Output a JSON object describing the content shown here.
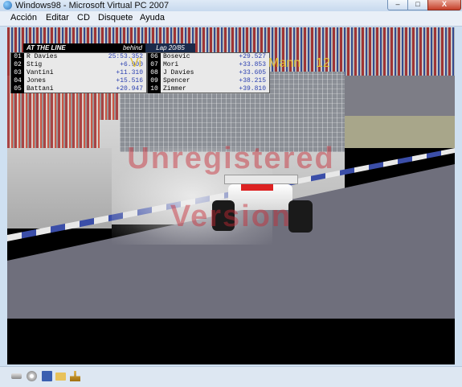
{
  "window": {
    "title": "Windows98 - Microsoft Virtual PC 2007",
    "controls": {
      "minimize": "‒",
      "maximize": "□",
      "close": "X"
    }
  },
  "menu": {
    "items": [
      "Acción",
      "Editar",
      "CD",
      "Disquete",
      "Ayuda"
    ]
  },
  "game": {
    "timing_header": "AT THE LINE",
    "behind_label": "behind",
    "lap_label": "Lap 20/85",
    "left_rows": [
      {
        "pos": "01",
        "name": "R Davies",
        "time": "25:53.352"
      },
      {
        "pos": "02",
        "name": "Stig",
        "time": "+6.900"
      },
      {
        "pos": "03",
        "name": "Vantini",
        "time": "+11.310"
      },
      {
        "pos": "04",
        "name": "Jones",
        "time": "+15.516"
      },
      {
        "pos": "05",
        "name": "Battani",
        "time": "+20.947"
      }
    ],
    "right_rows": [
      {
        "pos": "06",
        "name": "Bosevic",
        "time": "+29.527"
      },
      {
        "pos": "07",
        "name": "Mori",
        "time": "+33.853"
      },
      {
        "pos": "08",
        "name": "J Davies",
        "time": "+33.605"
      },
      {
        "pos": "09",
        "name": "Spencer",
        "time": "+38.215"
      },
      {
        "pos": "10",
        "name": "Zimmer",
        "time": "+39.810"
      }
    ],
    "driver_label_left": "Vi",
    "driver_label_right": "Mann",
    "driver_position": "12",
    "watermark_line1": "Unregistered",
    "watermark_line2": "Version"
  },
  "statusbar": {
    "icons": [
      "hard-disk-icon",
      "cd-drive-icon",
      "floppy-icon",
      "shared-folder-icon",
      "network-icon"
    ]
  }
}
